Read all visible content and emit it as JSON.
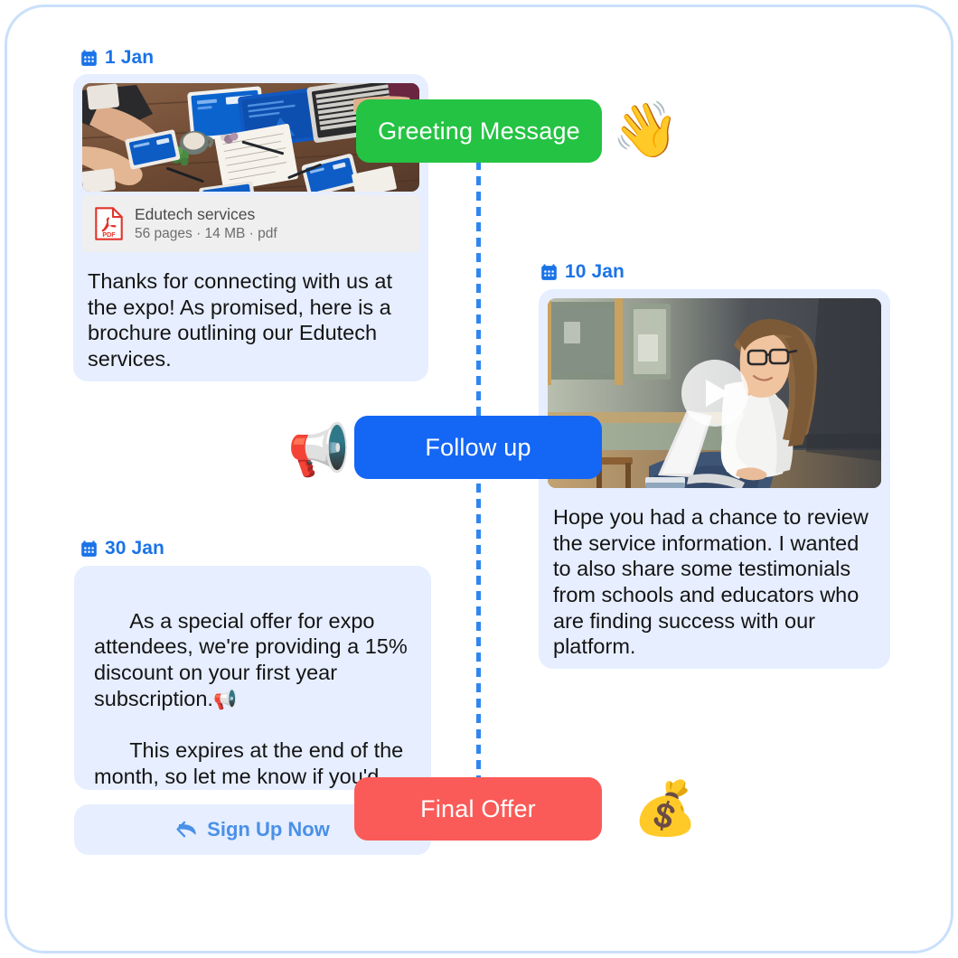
{
  "frame": {
    "border_color": "#c9e0fb"
  },
  "theme": {
    "accent_blue": "#1a73e8",
    "bubble_bg": "#e6eeff",
    "pill_green": "#24c343",
    "pill_blue": "#1466f5",
    "pill_red": "#fa5b58",
    "cta_text": "#4a90e8",
    "attachment_bg": "#efefef"
  },
  "timeline": {
    "spine_style": "dotted-vertical-blue"
  },
  "messages": [
    {
      "id": "msg-greeting",
      "date": "1 Jan",
      "date_icon": "calendar-icon",
      "has_image": true,
      "image_alt": "overhead photo of a wooden desk with tablets, laptop and phones showing blue screens, several people's hands",
      "attachment": {
        "icon": "pdf-file-icon",
        "title": "Edutech services",
        "meta": "56 pages · 14 MB · pdf"
      },
      "body": "Thanks for connecting with us at the expo! As promised, here is a brochure outlining our Edutech services."
    },
    {
      "id": "msg-followup",
      "date": "10 Jan",
      "date_icon": "calendar-icon",
      "has_video": true,
      "video_alt": "young woman with glasses sitting by a classroom wall using a laptop",
      "play_icon": "play-icon",
      "body": "Hope you had a chance to review the service information. I wanted to also share some testimonials from schools and educators who are finding success with our platform."
    },
    {
      "id": "msg-final-offer",
      "date": "30 Jan",
      "date_icon": "calendar-icon",
      "body_line1": "As a special offer for expo attendees, we're providing a 15% discount on your first year subscription.",
      "inline_emoji": "📢",
      "body_line2": "This expires at the end of the month, so let me know if you'd like to take advantage of this limited-time deal!",
      "cta": {
        "icon": "reply-arrow-icon",
        "label": "Sign Up Now"
      }
    }
  ],
  "stages": [
    {
      "id": "stage-greeting",
      "label": "Greeting Message",
      "color": "#24c343",
      "emoji": "👋",
      "emoji_name": "waving-hand-emoji",
      "emoji_side": "right"
    },
    {
      "id": "stage-followup",
      "label": "Follow up",
      "color": "#1466f5",
      "emoji": "📢",
      "emoji_name": "loudspeaker-emoji",
      "emoji_side": "left"
    },
    {
      "id": "stage-final",
      "label": "Final Offer",
      "color": "#fa5b58",
      "emoji": "💰",
      "emoji_name": "money-bag-emoji",
      "emoji_side": "right"
    }
  ]
}
